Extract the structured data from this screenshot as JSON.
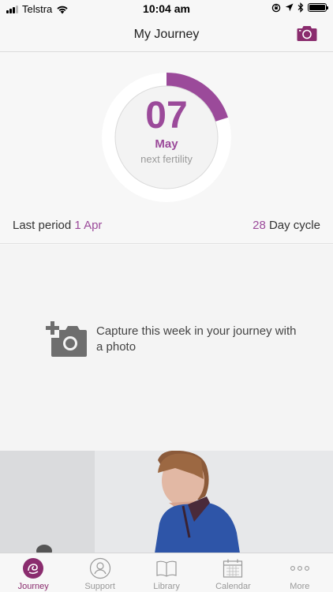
{
  "status_bar": {
    "carrier": "Telstra",
    "time": "10:04 am"
  },
  "header": {
    "title": "My Journey",
    "camera_icon": "camera-icon"
  },
  "summary": {
    "day": "07",
    "month": "May",
    "subtitle": "next fertility",
    "progress_fraction": 0.2,
    "last_period_label": "Last period",
    "last_period_value": "1 Apr",
    "cycle_value": "28",
    "cycle_label": "Day cycle",
    "accent_color": "#9b4a9a"
  },
  "capture": {
    "text": "Capture this week in your journey with a photo",
    "icon": "add-photo-icon"
  },
  "tabs": [
    {
      "label": "Journey",
      "icon": "journey-icon",
      "active": true
    },
    {
      "label": "Support",
      "icon": "support-icon",
      "active": false
    },
    {
      "label": "Library",
      "icon": "library-icon",
      "active": false
    },
    {
      "label": "Calendar",
      "icon": "calendar-icon",
      "active": false
    },
    {
      "label": "More",
      "icon": "more-icon",
      "active": false
    }
  ]
}
